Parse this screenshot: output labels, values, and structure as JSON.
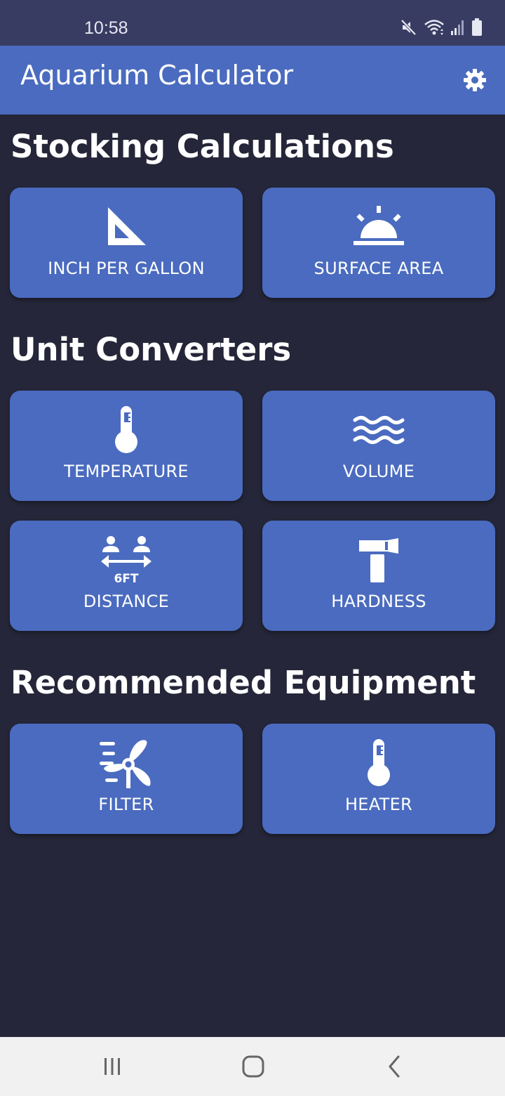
{
  "status_bar": {
    "time": "10:58",
    "icons": [
      "mute-icon",
      "wifi-icon",
      "signal-icon",
      "battery-icon"
    ]
  },
  "app_bar": {
    "title": "Aquarium Calculator",
    "settings_icon": "gear-icon"
  },
  "sections": [
    {
      "title": "Stocking Calculations",
      "cards": [
        {
          "label": "INCH PER GALLON",
          "icon": "set-square-icon"
        },
        {
          "label": "SURFACE AREA",
          "icon": "sunrise-icon"
        }
      ]
    },
    {
      "title": "Unit Converters",
      "cards": [
        {
          "label": "TEMPERATURE",
          "icon": "thermometer-icon"
        },
        {
          "label": "VOLUME",
          "icon": "water-waves-icon"
        },
        {
          "label": "DISTANCE",
          "icon": "social-distance-icon",
          "icon_text": "6FT"
        },
        {
          "label": "HARDNESS",
          "icon": "hammer-icon"
        }
      ]
    },
    {
      "title": "Recommended Equipment",
      "cards": [
        {
          "label": "FILTER",
          "icon": "fan-icon"
        },
        {
          "label": "HEATER",
          "icon": "thermometer-icon"
        }
      ]
    }
  ],
  "nav_bar": {
    "buttons": [
      "recent-apps-icon",
      "home-icon",
      "back-icon"
    ]
  },
  "colors": {
    "background": "#252639",
    "status_bar": "#393c62",
    "accent": "#4a6bbf",
    "text": "#ffffff",
    "nav_bar": "#f1f1f1"
  }
}
